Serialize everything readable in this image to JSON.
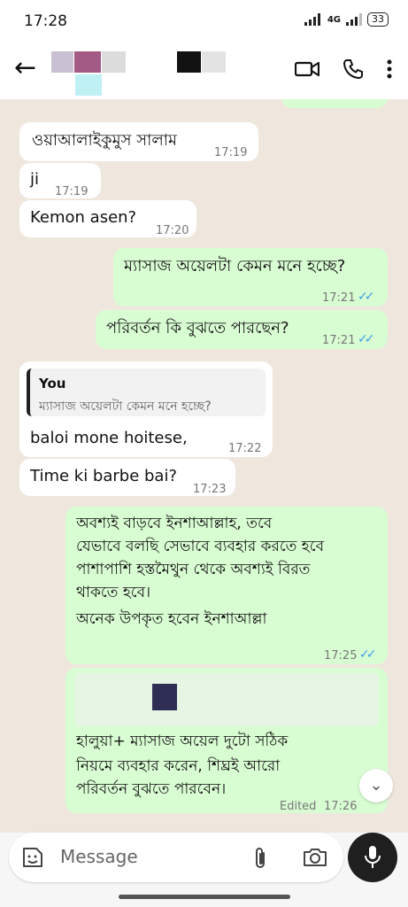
{
  "status": {
    "time": "17:28",
    "network": "4G",
    "battery": "33"
  },
  "messages": [
    {
      "text": "ওয়াআলাইকুমুস সালাম",
      "time": "17:19"
    },
    {
      "text": "ji",
      "time": "17:19"
    },
    {
      "text": "Kemon asen?",
      "time": "17:20"
    },
    {
      "text": "ম্যাসাজ অয়েলটা কেমন মনে হচ্ছে?",
      "time": "17:21",
      "ticks": "✓✓"
    },
    {
      "text": "পরিবর্তন কি বুঝতে পারছেন?",
      "time": "17:21",
      "ticks": "✓✓"
    },
    {
      "quote_name": "You",
      "quote_text": "ম্যাসাজ অয়েলটা কেমন মনে হচ্ছে?",
      "text": "baloi mone hoitese,",
      "time": "17:22"
    },
    {
      "text": "Time ki barbe bai?",
      "time": "17:23"
    },
    {
      "lines": [
        "অবশ্যই বাড়বে ইনশাআল্লাহ,  তবে",
        "যেভাবে বলছি সেভাবে ব্যবহার করতে হবে",
        "পাশাপাশি হস্তমৈথুন থেকে অবশ্যই বিরত",
        "থাকতে হবে।",
        "অনেক উপকৃত হবেন ইনশাআল্লা"
      ],
      "time": "17:25",
      "ticks": "✓✓"
    },
    {
      "lines": [
        "হালুয়া+ ম্যাসাজ অয়েল দুটো সঠিক",
        "নিয়মে ব্যবহার করেন, শিঘ্রই আরো",
        "পরিবর্তন বুঝতে পারবেন।"
      ],
      "edited": "Edited",
      "time": "17:26"
    }
  ],
  "composer": {
    "placeholder": "Message"
  }
}
